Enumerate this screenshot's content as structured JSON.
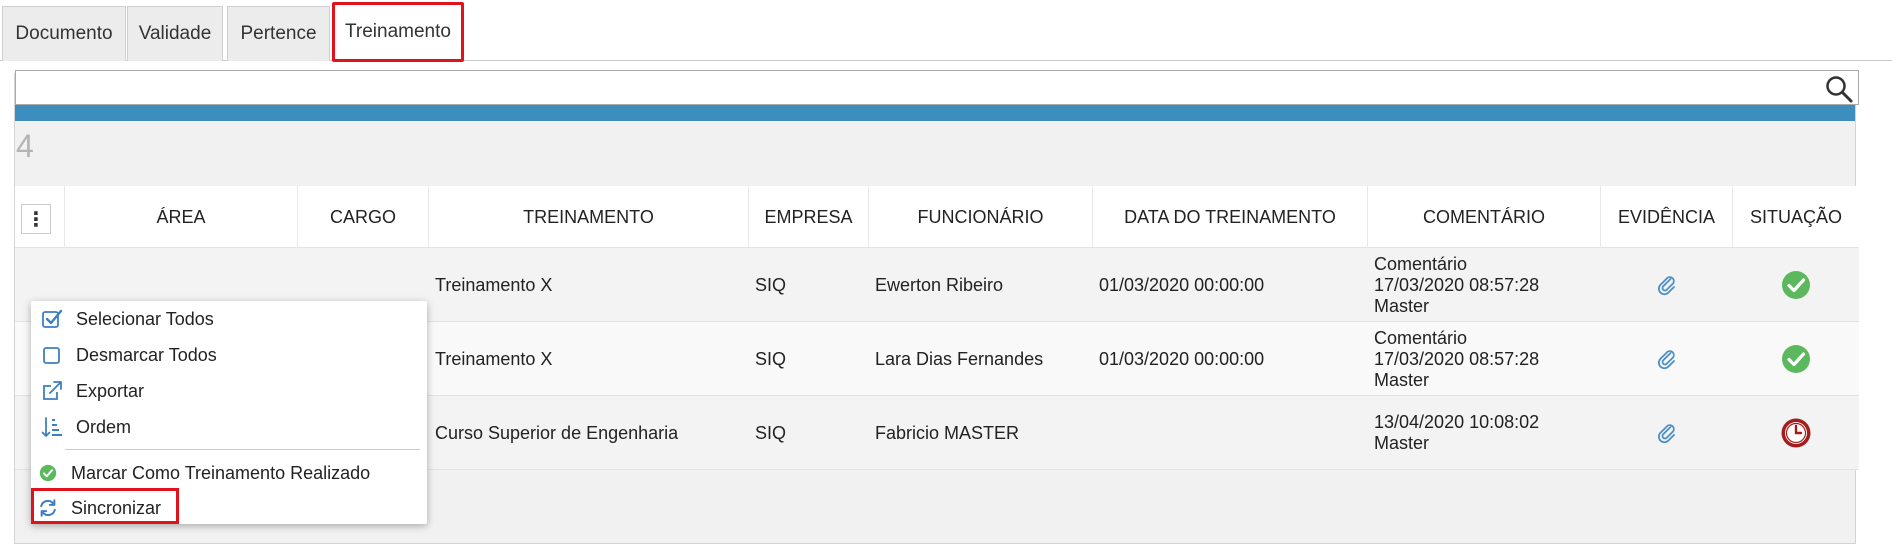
{
  "tabs": [
    {
      "label": "Documento"
    },
    {
      "label": "Validade"
    },
    {
      "label": "Pertence"
    },
    {
      "label": "Treinamento"
    }
  ],
  "panel": {
    "title": "Treinamento",
    "collapse_symbol": "«"
  },
  "search": {
    "value": "",
    "icon": "search-icon"
  },
  "count": "4",
  "table": {
    "menu_symbol": "⋮",
    "columns": [
      "ÁREA",
      "CARGO",
      "TREINAMENTO",
      "EMPRESA",
      "FUNCIONÁRIO",
      "DATA DO TREINAMENTO",
      "COMENTÁRIO",
      "EVIDÊNCIA",
      "SITUAÇÃO"
    ],
    "rows": [
      {
        "treinamento": "Treinamento X",
        "empresa": "SIQ",
        "funcionario": "Ewerton Ribeiro",
        "data": "01/03/2020 00:00:00",
        "comentario": [
          "Comentário",
          "17/03/2020 08:57:28",
          "Master"
        ],
        "evidencia_icon": "paperclip-icon",
        "situacao_icon": "check-circle-icon"
      },
      {
        "treinamento": "Treinamento X",
        "empresa": "SIQ",
        "funcionario": "Lara Dias Fernandes",
        "data": "01/03/2020 00:00:00",
        "comentario": [
          "Comentário",
          "17/03/2020 08:57:28",
          "Master"
        ],
        "evidencia_icon": "paperclip-icon",
        "situacao_icon": "check-circle-icon"
      },
      {
        "treinamento": "Curso Superior de Engenharia",
        "empresa": "SIQ",
        "funcionario": "Fabricio MASTER",
        "data": "",
        "comentario": [
          "13/04/2020 10:08:02",
          "Master"
        ],
        "evidencia_icon": "paperclip-icon",
        "situacao_icon": "clock-icon"
      }
    ]
  },
  "menu": {
    "items": [
      {
        "label": "Selecionar Todos",
        "icon": "checkbox-checked-icon"
      },
      {
        "label": "Desmarcar Todos",
        "icon": "checkbox-empty-icon"
      },
      {
        "label": "Exportar",
        "icon": "export-icon"
      },
      {
        "label": "Ordem",
        "icon": "sort-order-icon"
      },
      {
        "label": "Marcar Como Treinamento Realizado",
        "icon": "check-circle-icon"
      },
      {
        "label": "Sincronizar",
        "icon": "sync-icon"
      }
    ]
  },
  "colors": {
    "header_blue": "#3d8dbf",
    "highlight_red": "#e0121b",
    "success_green": "#5cb85c",
    "pending_red": "#a51c1c",
    "icon_blue": "#4a90c8"
  }
}
